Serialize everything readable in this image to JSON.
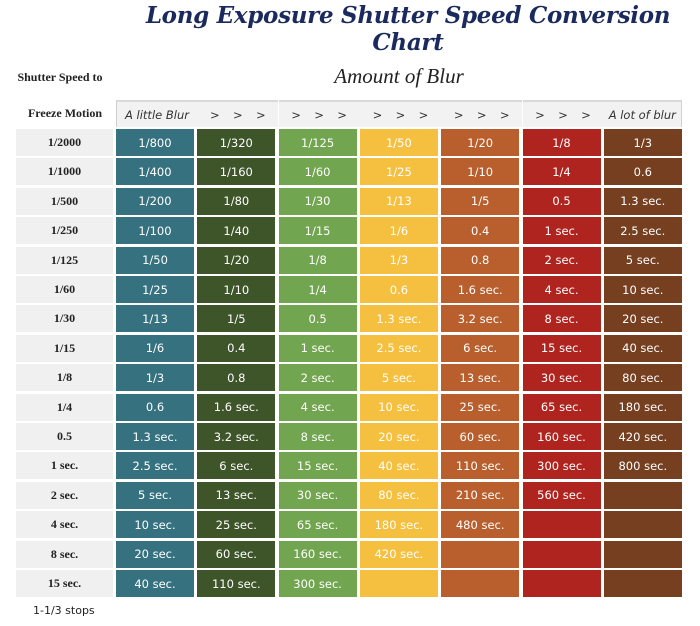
{
  "chart_data": {
    "type": "table",
    "title": "Long Exposure Shutter Speed Conversion Chart",
    "row_header_line1": "Shutter Speed to",
    "row_header_line2": "Freeze Motion",
    "column_group_label": "Amount of Blur",
    "columns": [
      {
        "label": "A little Blur",
        "style": "text",
        "color": "#35717f"
      },
      {
        "label": "> > >",
        "style": "arrows",
        "color": "#3e5429"
      },
      {
        "label": "> > >",
        "style": "arrows",
        "color": "#72a54f"
      },
      {
        "label": "> > >",
        "style": "arrows",
        "color": "#f5c040"
      },
      {
        "label": "> > >",
        "style": "arrows",
        "color": "#b85f2d"
      },
      {
        "label": "> > >",
        "style": "arrows",
        "color": "#b0241f"
      },
      {
        "label": "A lot of blur",
        "style": "text",
        "color": "#763f20"
      }
    ],
    "rows": [
      {
        "freeze": "1/2000",
        "values": [
          "1/800",
          "1/320",
          "1/125",
          "1/50",
          "1/20",
          "1/8",
          "1/3"
        ]
      },
      {
        "freeze": "1/1000",
        "values": [
          "1/400",
          "1/160",
          "1/60",
          "1/25",
          "1/10",
          "1/4",
          "0.6"
        ]
      },
      {
        "freeze": "1/500",
        "values": [
          "1/200",
          "1/80",
          "1/30",
          "1/13",
          "1/5",
          "0.5",
          "1.3 sec."
        ]
      },
      {
        "freeze": "1/250",
        "values": [
          "1/100",
          "1/40",
          "1/15",
          "1/6",
          "0.4",
          "1 sec.",
          "2.5 sec."
        ]
      },
      {
        "freeze": "1/125",
        "values": [
          "1/50",
          "1/20",
          "1/8",
          "1/3",
          "0.8",
          "2 sec.",
          "5 sec."
        ]
      },
      {
        "freeze": "1/60",
        "values": [
          "1/25",
          "1/10",
          "1/4",
          "0.6",
          "1.6 sec.",
          "4 sec.",
          "10 sec."
        ]
      },
      {
        "freeze": "1/30",
        "values": [
          "1/13",
          "1/5",
          "0.5",
          "1.3 sec.",
          "3.2 sec.",
          "8 sec.",
          "20 sec."
        ]
      },
      {
        "freeze": "1/15",
        "values": [
          "1/6",
          "0.4",
          "1 sec.",
          "2.5 sec.",
          "6 sec.",
          "15 sec.",
          "40 sec."
        ]
      },
      {
        "freeze": "1/8",
        "values": [
          "1/3",
          "0.8",
          "2 sec.",
          "5 sec.",
          "13 sec.",
          "30 sec.",
          "80 sec."
        ]
      },
      {
        "freeze": "1/4",
        "values": [
          "0.6",
          "1.6 sec.",
          "4 sec.",
          "10 sec.",
          "25 sec.",
          "65 sec.",
          "180 sec."
        ]
      },
      {
        "freeze": "0.5",
        "values": [
          "1.3 sec.",
          "3.2 sec.",
          "8 sec.",
          "20 sec.",
          "60 sec.",
          "160 sec.",
          "420 sec."
        ]
      },
      {
        "freeze": "1 sec.",
        "values": [
          "2.5 sec.",
          "6 sec.",
          "15 sec.",
          "40 sec.",
          "110 sec.",
          "300 sec.",
          "800 sec."
        ]
      },
      {
        "freeze": "2 sec.",
        "values": [
          "5 sec.",
          "13 sec.",
          "30 sec.",
          "80 sec.",
          "210 sec.",
          "560 sec.",
          ""
        ]
      },
      {
        "freeze": "4 sec.",
        "values": [
          "10 sec.",
          "25 sec.",
          "65 sec.",
          "180 sec.",
          "480 sec.",
          "",
          ""
        ]
      },
      {
        "freeze": "8 sec.",
        "values": [
          "20 sec.",
          "60 sec.",
          "160 sec.",
          "420 sec.",
          "",
          "",
          ""
        ]
      },
      {
        "freeze": "15 sec.",
        "values": [
          "40 sec.",
          "110 sec.",
          "300 sec.",
          "",
          "",
          "",
          ""
        ]
      }
    ],
    "footnote": "1-1/3 stops"
  },
  "colors": {
    "title": "#1b2a5c",
    "header_bg": "#f2f2f2",
    "row_label_bg": "#f0f0f0"
  }
}
